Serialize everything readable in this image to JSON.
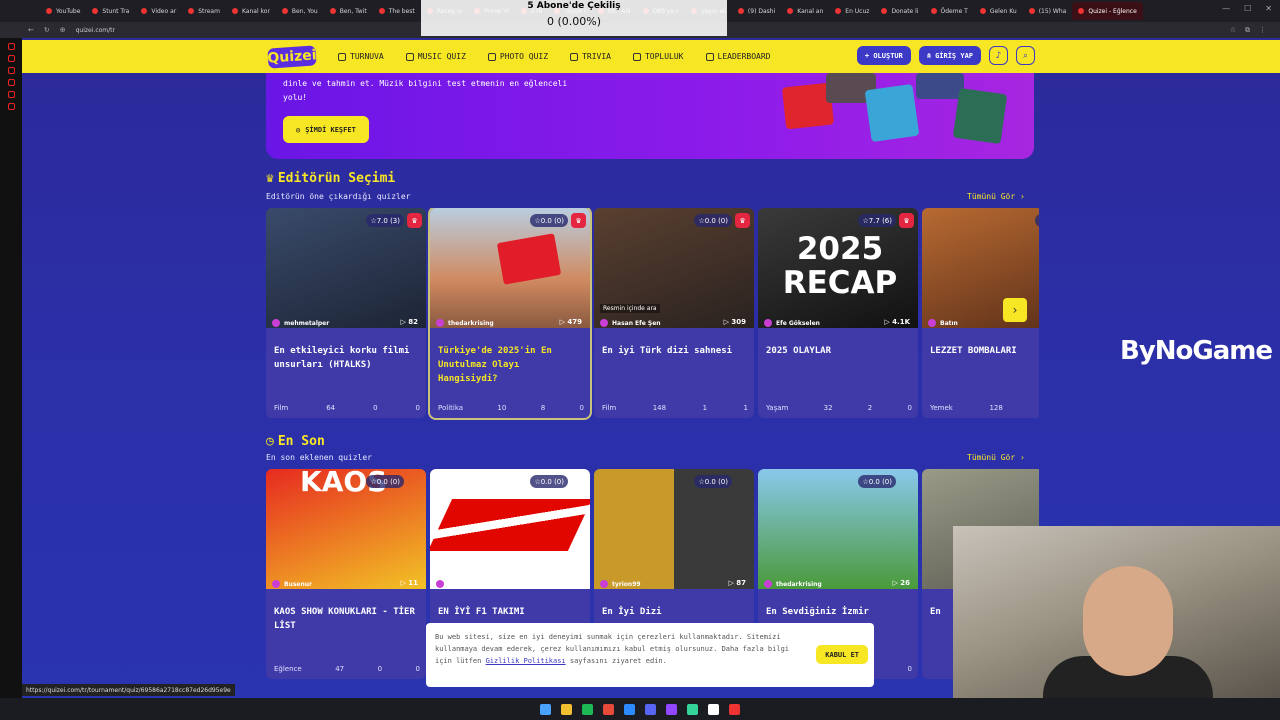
{
  "browser": {
    "tabs": [
      "YouTube",
      "Stunt Tra",
      "Video ar",
      "Stream",
      "Kanal kor",
      "Ben, You",
      "Ben, Twit",
      "The best",
      "Recep iv",
      "Prime Vi",
      "27b",
      "Yayge i",
      "hit - Alli",
      "OBS'ye c",
      "yayın wi",
      "(9) Dashi",
      "Kanal an",
      "En Ucuz",
      "Donate li",
      "Ödeme T",
      "Gelen Ku",
      "(15) Wha",
      "Quizei - Eğlence"
    ],
    "url": "quizei.com/tr"
  },
  "stream_overlay": {
    "title": "5 Abone'de Çekiliş",
    "progress": "0 (0.00%)"
  },
  "site": {
    "logo": "Quizei",
    "nav": [
      "TURNUVA",
      "MUSIC QUIZ",
      "PHOTO QUIZ",
      "TRIVIA",
      "TOPLULUK",
      "LEADERBOARD"
    ],
    "create": "+ OLUŞTUR",
    "login": "GİRİŞ YAP"
  },
  "hero": {
    "text": "dinle ve tahmin et. Müzik bilgini test etmenin en eğlenceli yolu!",
    "cta": "ŞİMDİ KEŞFET"
  },
  "editors": {
    "title": "Editörün Seçimi",
    "subtitle": "Editörün öne çıkardığı quizler",
    "see_all": "Tümünü Gör ›",
    "cards": [
      {
        "rating": "☆7.0 (3)",
        "author": "mehmetalper",
        "plays": "▷ 82",
        "title": "En etkileyici korku filmi unsurları (HTALKS)",
        "cat": "Film",
        "q": "64",
        "c": "0",
        "l": "0"
      },
      {
        "rating": "☆0.0 (0)",
        "author": "thedarkrising",
        "plays": "▷ 479",
        "title": "Türkiye'de 2025'in En Unutulmaz Olayı Hangisiydi?",
        "cat": "Politika",
        "q": "10",
        "c": "8",
        "l": "0"
      },
      {
        "rating": "☆0.0 (0)",
        "author": "Hasan Efe Şen",
        "plays": "▷ 309",
        "title": "En iyi Türk dizi sahnesi",
        "cat": "Film",
        "q": "148",
        "c": "1",
        "l": "1"
      },
      {
        "rating": "☆7.7 (6)",
        "author": "Efe Gökselen",
        "plays": "▷ 4.1K",
        "title": "2025 OLAYLAR",
        "cat": "Yaşam",
        "q": "32",
        "c": "2",
        "l": "0"
      },
      {
        "rating": "☆9.8",
        "author": "Batın",
        "plays": "",
        "title": "LEZZET BOMBALARI",
        "cat": "Yemek",
        "q": "128",
        "c": "",
        "l": ""
      }
    ]
  },
  "latest": {
    "title": "En Son",
    "subtitle": "En son eklenen quizler",
    "see_all": "Tümünü Gör ›",
    "cards": [
      {
        "rating": "☆0.0 (0)",
        "author": "Busenur",
        "plays": "▷ 11",
        "title": "KAOS SHOW KONUKLARI - TİER LİST",
        "cat": "Eğlence",
        "q": "47",
        "c": "0",
        "l": "0"
      },
      {
        "rating": "☆0.0 (0)",
        "author": "Ali ŞENTÜRK",
        "plays": "▷ 10",
        "title": "EN İYİ F1 TAKIMI",
        "cat": "",
        "q": "",
        "c": "",
        "l": ""
      },
      {
        "rating": "☆0.0 (0)",
        "author": "tyrion99",
        "plays": "▷ 87",
        "title": "En İyi Dizi",
        "cat": "",
        "q": "",
        "c": "",
        "l": ""
      },
      {
        "rating": "☆0.0 (0)",
        "author": "thedarkrising",
        "plays": "▷ 26",
        "title": "En Sevdiğiniz İzmir",
        "cat": "",
        "q": "",
        "c": "",
        "l": "0"
      },
      {
        "rating": "",
        "author": "",
        "plays": "",
        "title": "En",
        "cat": "",
        "q": "",
        "c": "",
        "l": ""
      }
    ]
  },
  "thumb_texts": {
    "recap": "2025 RECAP",
    "kaos": "KAOS",
    "resim": "Resmin içinde ara"
  },
  "cookie": {
    "text_a": "Bu web sitesi, size en iyi deneyimi sunmak için çerezleri kullanmaktadır. Sitemizi kullanmaya devam ederek, çerez kullanımımızı kabul etmiş olursunuz. Daha fazla bilgi için lütfen",
    "link": "Gizlilik Politikası",
    "text_b": "sayfasını ziyaret edin.",
    "accept": "KABUL ET"
  },
  "watermark": "ByNoGame",
  "status_url": "https://quizei.com/tr/tournament/quiz/69586a2718cc87ed26d95e9e",
  "colors": {
    "yellow": "#f7e624",
    "bg": "#2b2fa8",
    "card": "#3f3aa8",
    "crown": "#e42640"
  }
}
